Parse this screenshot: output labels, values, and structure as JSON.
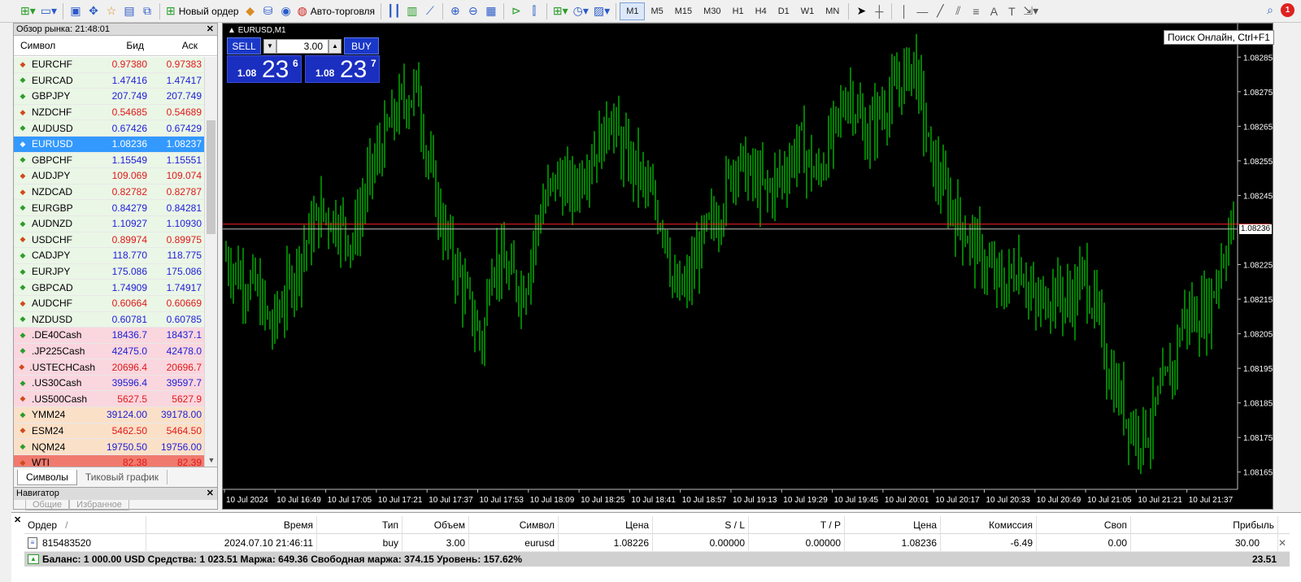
{
  "toolbar": {
    "new_order_label": "Новый ордер",
    "autotrading_label": "Авто-торговля",
    "timeframes": [
      "M1",
      "M5",
      "M15",
      "M30",
      "H1",
      "H4",
      "D1",
      "W1",
      "MN"
    ],
    "active_timeframe": "M1",
    "notification_count": "1"
  },
  "tooltip": "Поиск Онлайн, Ctrl+F1",
  "market_watch": {
    "title": "Обзор рынка: 21:48:01",
    "col_symbol": "Символ",
    "col_bid": "Бид",
    "col_ask": "Аск",
    "rows": [
      {
        "symbol": "EURCHF",
        "bid": "0.97380",
        "ask": "0.97383",
        "dir": "down",
        "group": "fx"
      },
      {
        "symbol": "EURCAD",
        "bid": "1.47416",
        "ask": "1.47417",
        "dir": "up",
        "group": "fx"
      },
      {
        "symbol": "GBPJPY",
        "bid": "207.749",
        "ask": "207.749",
        "dir": "up",
        "group": "fx"
      },
      {
        "symbol": "NZDCHF",
        "bid": "0.54685",
        "ask": "0.54689",
        "dir": "down",
        "group": "fx"
      },
      {
        "symbol": "AUDUSD",
        "bid": "0.67426",
        "ask": "0.67429",
        "dir": "up",
        "group": "fx"
      },
      {
        "symbol": "EURUSD",
        "bid": "1.08236",
        "ask": "1.08237",
        "dir": "up",
        "group": "fx",
        "selected": true
      },
      {
        "symbol": "GBPCHF",
        "bid": "1.15549",
        "ask": "1.15551",
        "dir": "up",
        "group": "fx"
      },
      {
        "symbol": "AUDJPY",
        "bid": "109.069",
        "ask": "109.074",
        "dir": "down",
        "group": "fx"
      },
      {
        "symbol": "NZDCAD",
        "bid": "0.82782",
        "ask": "0.82787",
        "dir": "down",
        "group": "fx"
      },
      {
        "symbol": "EURGBP",
        "bid": "0.84279",
        "ask": "0.84281",
        "dir": "up",
        "group": "fx"
      },
      {
        "symbol": "AUDNZD",
        "bid": "1.10927",
        "ask": "1.10930",
        "dir": "up",
        "group": "fx"
      },
      {
        "symbol": "USDCHF",
        "bid": "0.89974",
        "ask": "0.89975",
        "dir": "down",
        "group": "fx"
      },
      {
        "symbol": "CADJPY",
        "bid": "118.770",
        "ask": "118.775",
        "dir": "up",
        "group": "fx"
      },
      {
        "symbol": "EURJPY",
        "bid": "175.086",
        "ask": "175.086",
        "dir": "up",
        "group": "fx"
      },
      {
        "symbol": "GBPCAD",
        "bid": "1.74909",
        "ask": "1.74917",
        "dir": "up",
        "group": "fx"
      },
      {
        "symbol": "AUDCHF",
        "bid": "0.60664",
        "ask": "0.60669",
        "dir": "down",
        "group": "fx"
      },
      {
        "symbol": "NZDUSD",
        "bid": "0.60781",
        "ask": "0.60785",
        "dir": "up",
        "group": "fx"
      },
      {
        "symbol": ".DE40Cash",
        "bid": "18436.7",
        "ask": "18437.1",
        "dir": "up",
        "group": "idx"
      },
      {
        "symbol": ".JP225Cash",
        "bid": "42475.0",
        "ask": "42478.0",
        "dir": "up",
        "group": "idx"
      },
      {
        "symbol": ".USTECHCash",
        "bid": "20696.4",
        "ask": "20696.7",
        "dir": "down",
        "group": "idx"
      },
      {
        "symbol": ".US30Cash",
        "bid": "39596.4",
        "ask": "39597.7",
        "dir": "up",
        "group": "idx"
      },
      {
        "symbol": ".US500Cash",
        "bid": "5627.5",
        "ask": "5627.9",
        "dir": "down",
        "group": "idx"
      },
      {
        "symbol": "YMM24",
        "bid": "39124.00",
        "ask": "39178.00",
        "dir": "up",
        "group": "fut"
      },
      {
        "symbol": "ESM24",
        "bid": "5462.50",
        "ask": "5464.50",
        "dir": "down",
        "group": "fut"
      },
      {
        "symbol": "NQM24",
        "bid": "19750.50",
        "ask": "19756.00",
        "dir": "up",
        "group": "fut"
      },
      {
        "symbol": "WTI",
        "bid": "82.38",
        "ask": "82.39",
        "dir": "down",
        "group": "cmd"
      }
    ],
    "tabs": [
      "Символы",
      "Тиковый график"
    ]
  },
  "navigator": {
    "title": "Навигатор",
    "tabs": [
      "Общие",
      "Избранное"
    ]
  },
  "chart": {
    "title": "EURUSD,M1",
    "current_price": "1.08236",
    "price_labels": [
      "1.08285",
      "1.08275",
      "1.08265",
      "1.08255",
      "1.08245",
      "1.08225",
      "1.08215",
      "1.08205",
      "1.08195",
      "1.08185",
      "1.08175",
      "1.08165"
    ],
    "time_labels": [
      "10 Jul 2024",
      "10 Jul 16:49",
      "10 Jul 17:05",
      "10 Jul 17:21",
      "10 Jul 17:37",
      "10 Jul 17:53",
      "10 Jul 18:09",
      "10 Jul 18:25",
      "10 Jul 18:41",
      "10 Jul 18:57",
      "10 Jul 19:13",
      "10 Jul 19:29",
      "10 Jul 19:45",
      "10 Jul 20:01",
      "10 Jul 20:17",
      "10 Jul 20:33",
      "10 Jul 20:49",
      "10 Jul 21:05",
      "10 Jul 21:21",
      "10 Jul 21:37"
    ],
    "candle_color": "#00ff00",
    "bid_line_color": "#c0c0c0",
    "ask_line_color": "#ff2020",
    "price_range": [
      1.0816,
      1.0829
    ]
  },
  "one_click": {
    "sell_label": "SELL",
    "buy_label": "BUY",
    "volume": "3.00",
    "sell_prefix": "1.08",
    "sell_big": "23",
    "sell_sup": "6",
    "buy_prefix": "1.08",
    "buy_big": "23",
    "buy_sup": "7"
  },
  "terminal": {
    "headers": [
      "Ордер",
      "Время",
      "Тип",
      "Объем",
      "Символ",
      "Цена",
      "S / L",
      "T / P",
      "Цена",
      "Комиссия",
      "Своп",
      "Прибыль"
    ],
    "sort_marker": "/",
    "order": {
      "ticket": "815483520",
      "time": "2024.07.10 21:46:11",
      "type": "buy",
      "volume": "3.00",
      "symbol": "eurusd",
      "open_price": "1.08226",
      "sl": "0.00000",
      "tp": "0.00000",
      "price": "1.08236",
      "commission": "-6.49",
      "swap": "0.00",
      "profit": "30.00"
    },
    "balance_line": "Баланс: 1 000.00 USD  Средства: 1 023.51  Маржа: 649.36  Свободная маржа: 374.15  Уровень: 157.62%",
    "total_profit": "23.51"
  }
}
